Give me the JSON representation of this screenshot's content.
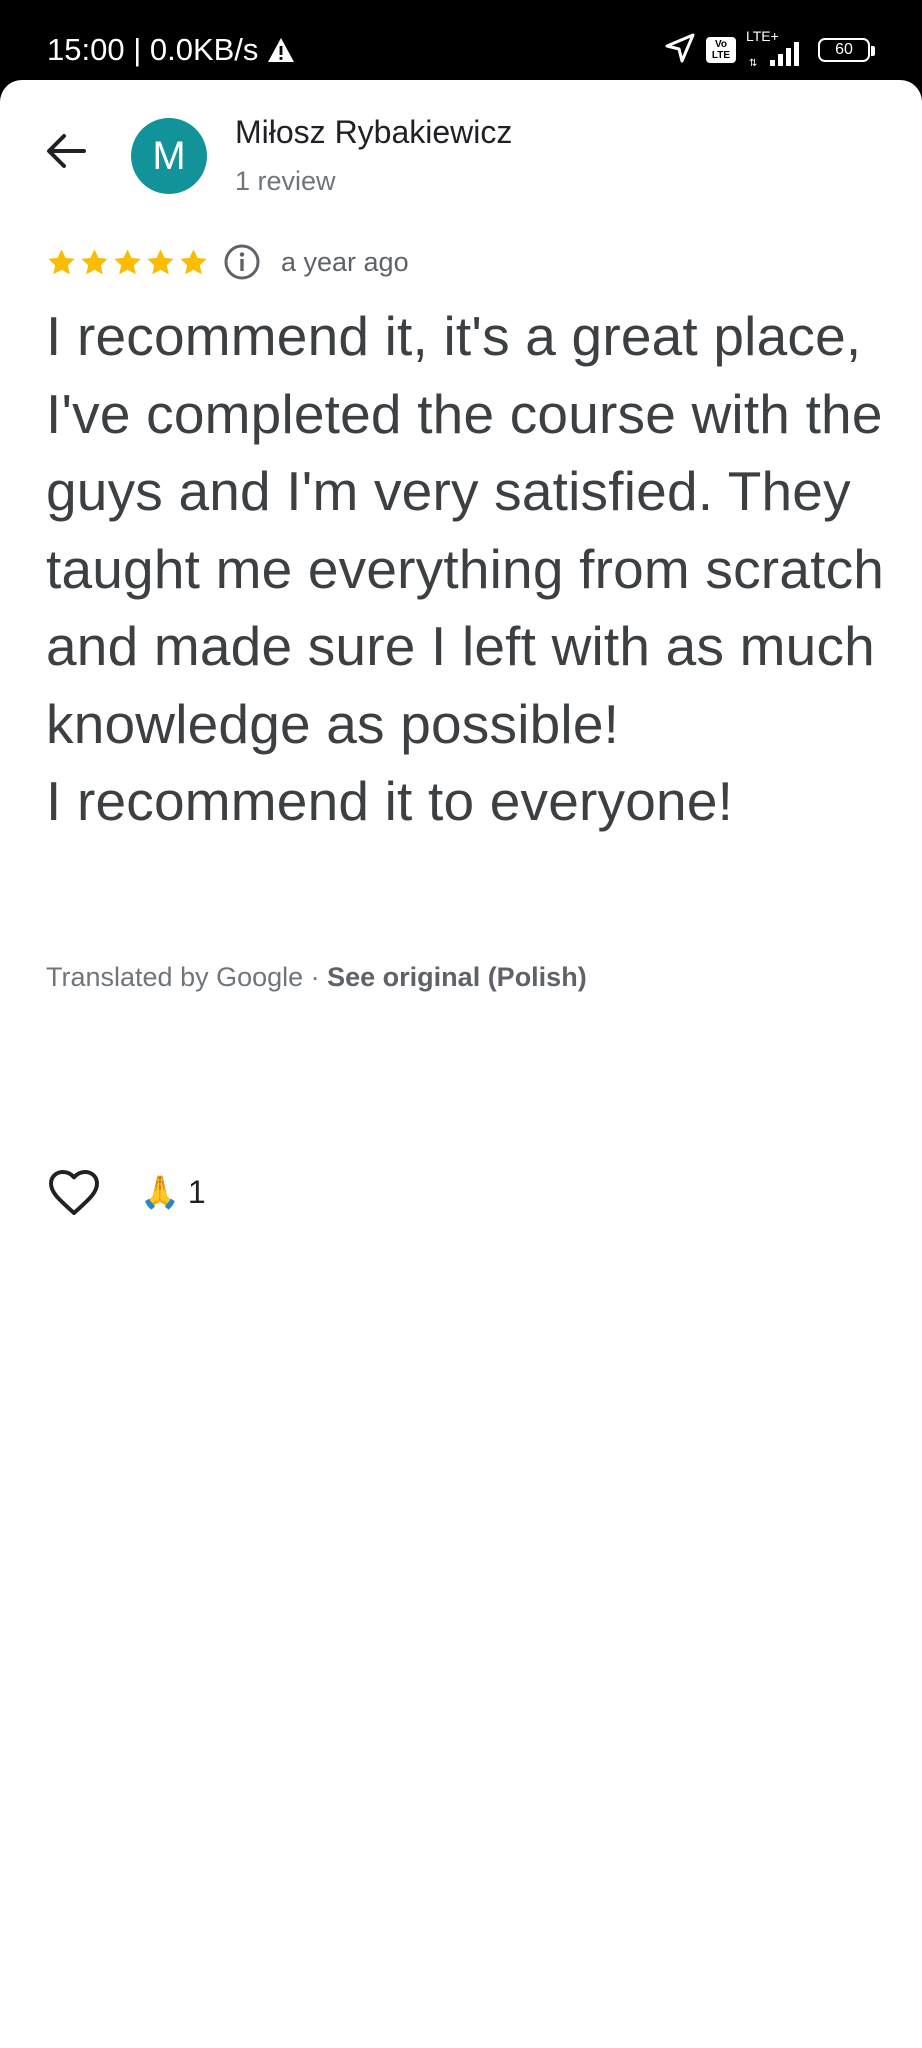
{
  "status_bar": {
    "time_speed": "15:00 | 0.0KB/s",
    "volte": "Vo\nLTE",
    "network": "LTE+",
    "battery": "60"
  },
  "author": {
    "initial": "M",
    "avatar_color": "#12939a",
    "name": "Miłosz Rybakiewicz",
    "reviews": "1 review"
  },
  "review": {
    "rating": 5,
    "star_color": "#fbbc04",
    "time": "a year ago",
    "text": "I recommend it, it's a great place, I've completed the course with the guys and I'm very satisfied. They taught me everything from scratch and made sure I left with as much knowledge as possible!\nI recommend it to everyone!"
  },
  "translation": {
    "note": "Translated by Google · ",
    "link": "See original (Polish)"
  },
  "reactions": {
    "emoji": "🙏",
    "count": "1"
  },
  "icons": {
    "back": "arrow-back-icon",
    "info": "info-icon",
    "like": "heart-outline-icon",
    "warning": "warning-icon",
    "location": "navigation-arrow-icon",
    "signal": "signal-bars-icon",
    "battery": "battery-icon"
  }
}
